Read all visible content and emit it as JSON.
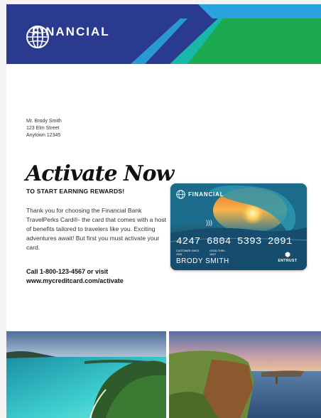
{
  "header": {
    "brand": "FINANCIAL",
    "colors": {
      "navy": "#2a3a8f",
      "teal": "#18b7a8",
      "green": "#1ca951",
      "blue": "#2aa3dd"
    }
  },
  "address": {
    "lines": [
      "Mr. Brody Smith",
      "123 Elm Street",
      "Anytown 12345"
    ]
  },
  "headline": "Activate Now",
  "subheadline": "TO START EARNING REWARDS!",
  "body": "Thank you for choosing the Financial Bank TravelPerks Card®- the card that comes with a host of benefits tailored to travelers like you. Exciting adventures await! But first you must activate your card.",
  "cta": {
    "line1": "Call 1-800-123-4567 or visit",
    "line2": "www.mycreditcard.com/activate"
  },
  "card": {
    "brand": "FINANCIAL",
    "contactless_icon": "contactless-icon",
    "number": "4247 6804 5393 2091",
    "customer_since_label": "CUSTOMER SINCE",
    "customer_since_value": "2005",
    "good_thru_label": "GOOD THRU",
    "good_thru_value": "10/27",
    "name": "BRODY SMITH",
    "issuer": "ENTRUST"
  },
  "photos": {
    "left": "tropical-island-photo",
    "right": "sea-cliffs-photo"
  }
}
